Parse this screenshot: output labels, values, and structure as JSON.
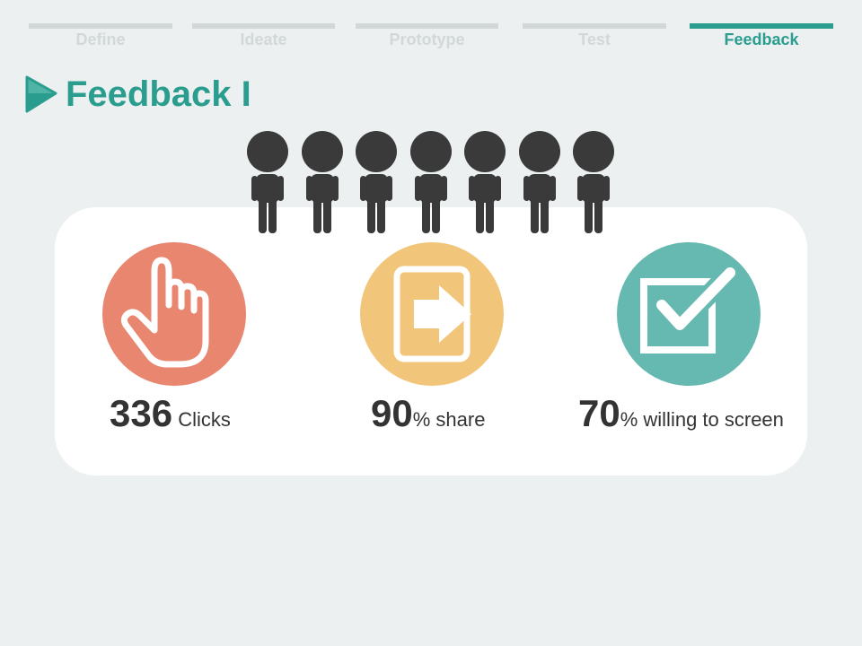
{
  "stages": [
    {
      "label": "Define",
      "active": false
    },
    {
      "label": "Ideate",
      "active": false
    },
    {
      "label": "Prototype",
      "active": false
    },
    {
      "label": "Test",
      "active": false
    },
    {
      "label": "Feedback",
      "active": true
    }
  ],
  "title": "Feedback I",
  "people_count": 7,
  "metrics": [
    {
      "value": "336",
      "suffix": " Clicks",
      "icon": "pointer-hand-icon",
      "color": "#e8866f"
    },
    {
      "value": "90",
      "suffix": "% share",
      "icon": "exit-arrow-icon",
      "color": "#f2c67a"
    },
    {
      "value": "70",
      "suffix": "% willing to screen",
      "icon": "checkbox-check-icon",
      "color": "#66b9b0"
    }
  ],
  "colors": {
    "accent": "#2a9d8f",
    "stage_inactive": "#d2d7d7",
    "person": "#3a3a3a",
    "background": "#ecf0f1"
  }
}
